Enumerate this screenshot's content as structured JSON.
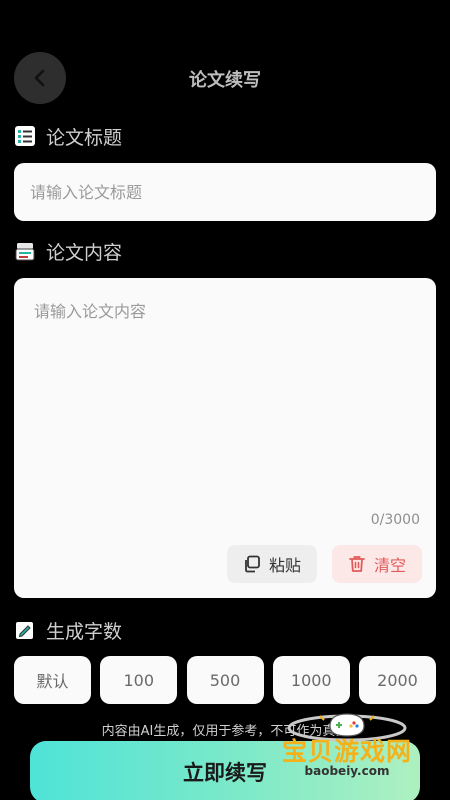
{
  "header": {
    "title": "论文续写"
  },
  "sections": {
    "title_label": "论文标题",
    "content_label": "论文内容",
    "count_label": "生成字数"
  },
  "title_input": {
    "placeholder": "请输入论文标题",
    "value": ""
  },
  "content_input": {
    "placeholder": "请输入论文内容",
    "value": "",
    "counter": "0/3000"
  },
  "buttons": {
    "paste": "粘贴",
    "clear": "清空",
    "submit": "立即续写"
  },
  "word_count_options": [
    "默认",
    "100",
    "500",
    "1000",
    "2000"
  ],
  "disclaimer": "内容由AI生成，仅用于参考，不可作为真实",
  "watermark": {
    "text": "宝贝游戏网",
    "url": "baobeiy.com"
  },
  "colors": {
    "clear_text": "#e35a5a",
    "submit_gradient_start": "#4fe3d8",
    "submit_gradient_end": "#aef0c0"
  }
}
